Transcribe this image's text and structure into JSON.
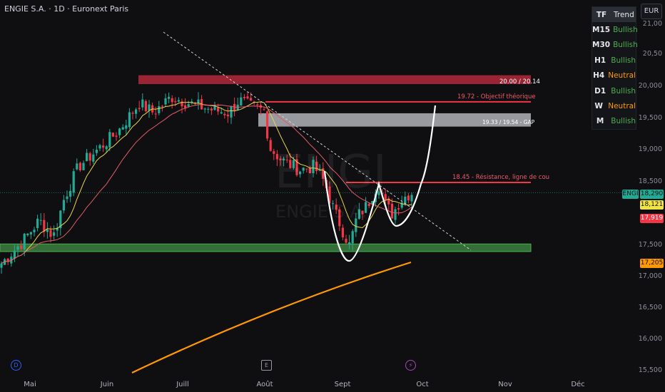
{
  "header": {
    "title": "ENGIE S.A. · 1D · Euronext Paris",
    "currency": "EUR"
  },
  "watermark": {
    "ticker": "ENGI",
    "name": "ENGIE S.A."
  },
  "trend_table": {
    "col_tf": "TF",
    "col_trend": "Trend",
    "rows": [
      {
        "tf": "M15",
        "trend": "Bullish",
        "color": "#4caf50"
      },
      {
        "tf": "M30",
        "trend": "Bullish",
        "color": "#4caf50"
      },
      {
        "tf": "H1",
        "trend": "Bullish",
        "color": "#4caf50"
      },
      {
        "tf": "H4",
        "trend": "Neutral",
        "color": "#ff9800"
      },
      {
        "tf": "D1",
        "trend": "Bullish",
        "color": "#4caf50"
      },
      {
        "tf": "W",
        "trend": "Neutral",
        "color": "#ff9800"
      },
      {
        "tf": "M",
        "trend": "Bullish",
        "color": "#4caf50"
      }
    ]
  },
  "annotations": {
    "zone_top": "20.00 / 20.14",
    "objective": "19.72 - Objectif théorique",
    "gap": "19.33 / 19.54 - GAP",
    "resistance": "18.45 - Résistance, ligne de cou"
  },
  "price_axis": {
    "labels": [
      "21,00",
      "20,50",
      "20,000",
      "19,500",
      "19,000",
      "18,500",
      "17,500",
      "17,000",
      "16,500",
      "16,000",
      "15,500"
    ],
    "tags": [
      {
        "name": "ENGI",
        "value": "18,290",
        "color": "#22ab94"
      },
      {
        "name": "ma-fast",
        "value": "18,121",
        "color": "#f0e442"
      },
      {
        "name": "ma-slow",
        "value": "17,919",
        "color": "#f23645"
      },
      {
        "name": "ma-long",
        "value": "17,205",
        "color": "#ff9800"
      }
    ]
  },
  "time_axis": {
    "months": [
      "Mai",
      "Juin",
      "Juill",
      "Août",
      "Sept",
      "Oct",
      "Nov",
      "Déc"
    ]
  },
  "events": [
    {
      "symbol": "D",
      "color": "#2962ff"
    },
    {
      "symbol": "E",
      "color": "#9598a1"
    },
    {
      "symbol": "⚡",
      "color": "#ab47bc"
    }
  ],
  "colors": {
    "up": "#22ab94",
    "down": "#f23645",
    "ma_fast": "#e8d44d",
    "ma_slow": "#e05c68",
    "ma_long": "#ff9800",
    "zone_support": "#4caf50",
    "zone_resist": "#b2283a"
  }
}
